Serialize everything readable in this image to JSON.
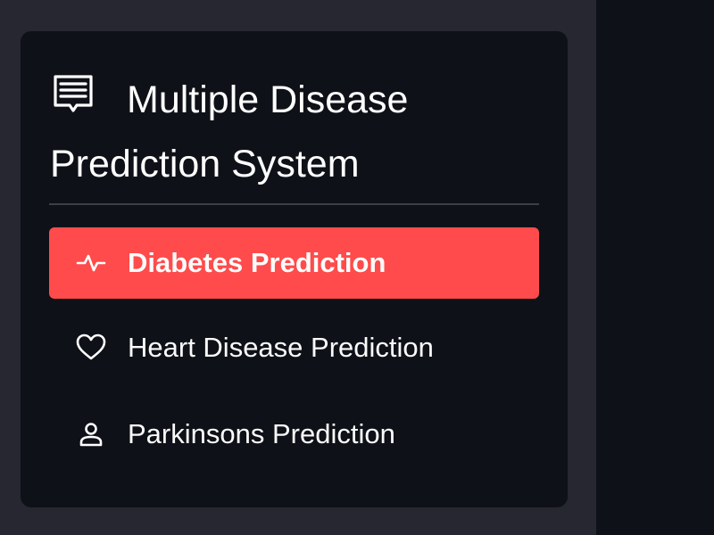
{
  "sidebar": {
    "menu": {
      "title": "Multiple Disease Prediction System",
      "title_icon": "clipboard-list-icon",
      "items": [
        {
          "label": "Diabetes Prediction",
          "icon": "activity-icon",
          "selected": true
        },
        {
          "label": "Heart Disease Prediction",
          "icon": "heart-icon",
          "selected": false
        },
        {
          "label": "Parkinsons Prediction",
          "icon": "person-icon",
          "selected": false
        }
      ]
    }
  },
  "colors": {
    "sidebar_bg": "#262730",
    "card_bg": "#0e1117",
    "accent": "#ff4b4b",
    "text": "#fafafa"
  }
}
